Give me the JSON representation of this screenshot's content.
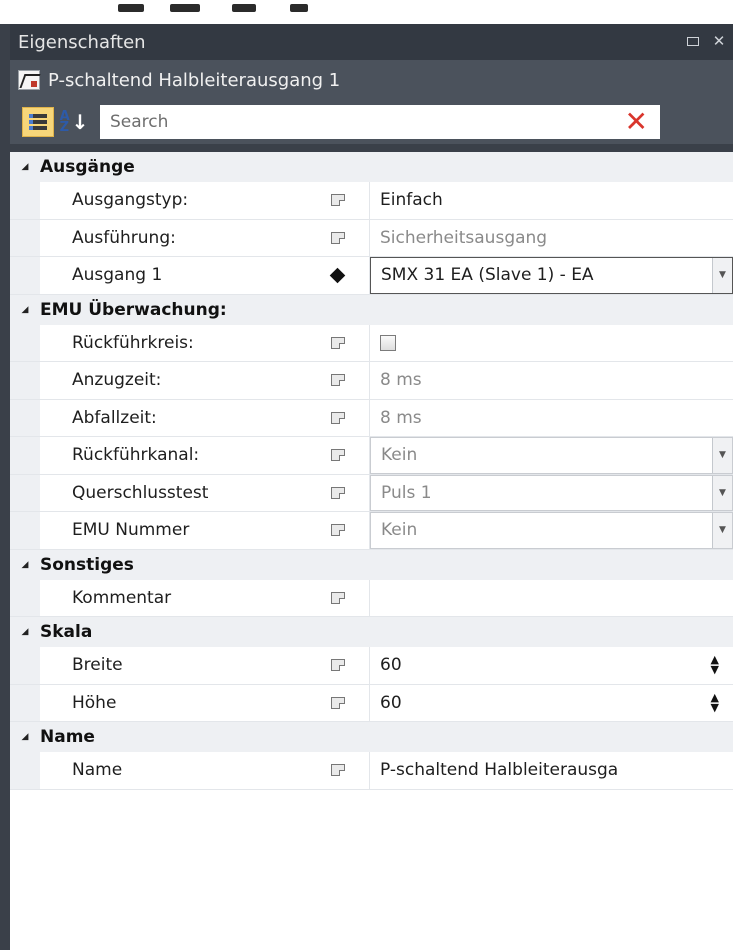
{
  "window": {
    "title": "Eigenschaften",
    "object_name": "P-schaltend Halbleiterausgang 1"
  },
  "toolbar": {
    "categorized_icon": "categorized-view-icon",
    "alphabetical_icon": "sort-az-icon",
    "search_placeholder": "Search",
    "clear_icon": "clear-x-icon"
  },
  "categories": {
    "ausgaenge": {
      "label": "Ausgänge",
      "rows": [
        {
          "name": "Ausgangstyp:",
          "value": "Einfach"
        },
        {
          "name": "Ausführung:",
          "value": "Sicherheitsausgang"
        },
        {
          "name": "Ausgang 1",
          "value": "SMX 31 EA (Slave 1) - EA"
        }
      ]
    },
    "emu": {
      "label": "EMU Überwachung:",
      "rows": [
        {
          "name": "Rückführkreis:",
          "value": ""
        },
        {
          "name": "Anzugzeit:",
          "value": "8 ms"
        },
        {
          "name": "Abfallzeit:",
          "value": "8 ms"
        },
        {
          "name": "Rückführkanal:",
          "value": "Kein"
        },
        {
          "name": "Querschlusstest",
          "value": "Puls 1"
        },
        {
          "name": "EMU Nummer",
          "value": "Kein"
        }
      ]
    },
    "sonstiges": {
      "label": "Sonstiges",
      "rows": [
        {
          "name": "Kommentar",
          "value": ""
        }
      ]
    },
    "skala": {
      "label": "Skala",
      "rows": [
        {
          "name": "Breite",
          "value": "60"
        },
        {
          "name": "Höhe",
          "value": "60"
        }
      ]
    },
    "name": {
      "label": "Name",
      "rows": [
        {
          "name": "Name",
          "value": "P-schaltend Halbleiterausga"
        }
      ]
    }
  },
  "colors": {
    "panel_bg": "#3a4049",
    "active_button": "#f7d67a",
    "clear_icon": "#d9352c"
  }
}
